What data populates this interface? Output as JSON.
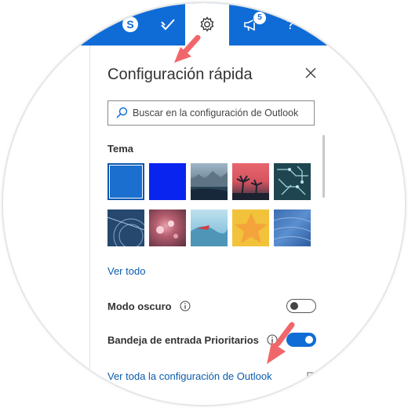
{
  "topbar": {
    "notification_count": "5",
    "icons": [
      "skype-icon",
      "todo-check-icon",
      "gear-icon",
      "megaphone-icon",
      "help-icon"
    ],
    "color": "#0f6cd6"
  },
  "panel": {
    "title": "Configuración rápida",
    "search_placeholder": "Buscar en la configuración de Outlook",
    "theme_heading": "Tema",
    "themes": [
      {
        "name": "blue-solid",
        "selected": true
      },
      {
        "name": "bright-blue",
        "selected": false
      },
      {
        "name": "mountain-lake",
        "selected": false
      },
      {
        "name": "palm-sunset",
        "selected": false
      },
      {
        "name": "circuit-board",
        "selected": false
      },
      {
        "name": "aviation-blueprint",
        "selected": false
      },
      {
        "name": "pink-bokeh",
        "selected": false
      },
      {
        "name": "wave-red-boat",
        "selected": false
      },
      {
        "name": "orange-star",
        "selected": false
      },
      {
        "name": "blue-texture",
        "selected": false
      }
    ],
    "view_all": "Ver todo",
    "dark_mode_label": "Modo oscuro",
    "dark_mode_on": false,
    "focused_inbox_label": "Bandeja de entrada Prioritarios",
    "focused_inbox_on": true,
    "all_settings_link": "Ver toda la configuración de Outlook"
  },
  "accent_colors": {
    "link": "#0b5cad",
    "arrow": "#f0676b"
  }
}
